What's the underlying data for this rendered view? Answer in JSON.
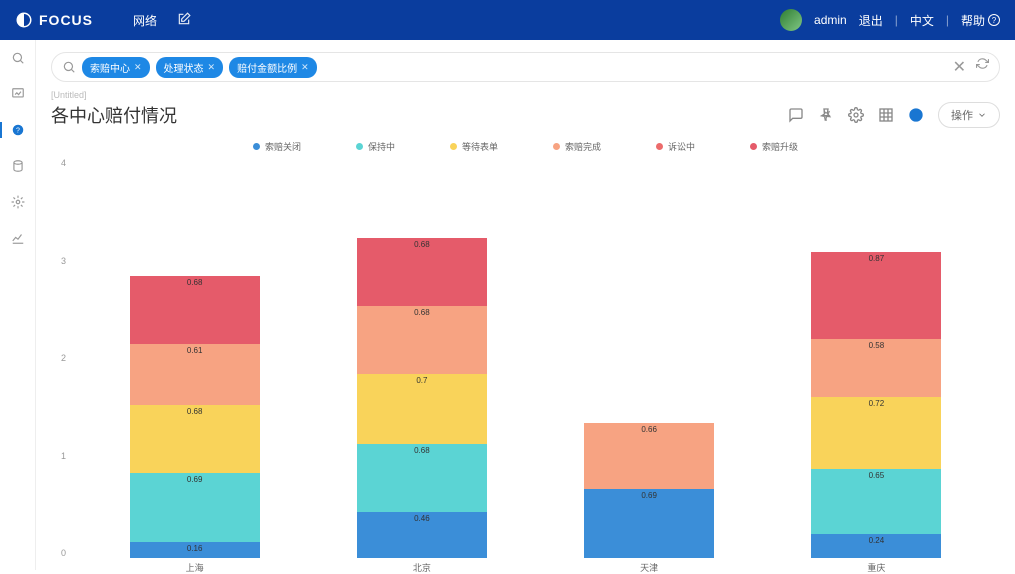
{
  "header": {
    "brand": "FOCUS",
    "nav_network": "网络",
    "user": "admin",
    "logout": "退出",
    "lang": "中文",
    "help": "帮助"
  },
  "search": {
    "pills": [
      {
        "label": "索赔中心",
        "close": "✕"
      },
      {
        "label": "处理状态",
        "close": "✕"
      },
      {
        "label": "赔付金额比例",
        "close": "✕"
      }
    ]
  },
  "breadcrumb": "[Untitled]",
  "title": "各中心赔付情况",
  "actions": {
    "op": "操作"
  },
  "legend": [
    {
      "label": "索赔关闭",
      "color": "#3b8ed8"
    },
    {
      "label": "保持中",
      "color": "#5bd4d4"
    },
    {
      "label": "等待表单",
      "color": "#f9d35a"
    },
    {
      "label": "索赔完成",
      "color": "#f7a382"
    },
    {
      "label": "诉讼中",
      "color": "#ec6b6b"
    },
    {
      "label": "索赔升级",
      "color": "#e55b6a"
    }
  ],
  "y_ticks": [
    "4",
    "3",
    "2",
    "1",
    "0"
  ],
  "chart_data": {
    "type": "bar",
    "stacked": true,
    "ylim": [
      0,
      4
    ],
    "categories": [
      "上海",
      "北京",
      "天津",
      "重庆"
    ],
    "series": [
      {
        "name": "索赔关闭",
        "color": "#3b8ed8",
        "values": [
          0.16,
          0.46,
          0.69,
          0.24
        ]
      },
      {
        "name": "保持中",
        "color": "#5bd4d4",
        "values": [
          0.69,
          0.68,
          null,
          0.65
        ]
      },
      {
        "name": "等待表单",
        "color": "#f9d35a",
        "values": [
          0.68,
          0.7,
          null,
          0.72
        ]
      },
      {
        "name": "索赔完成",
        "color": "#f7a382",
        "values": [
          0.61,
          0.68,
          0.66,
          0.58
        ]
      },
      {
        "name": "诉讼中",
        "color": "#ec6b6b",
        "values": [
          null,
          null,
          null,
          null
        ]
      },
      {
        "name": "索赔升级",
        "color": "#e55b6a",
        "values": [
          0.68,
          0.68,
          null,
          0.87
        ]
      }
    ]
  }
}
